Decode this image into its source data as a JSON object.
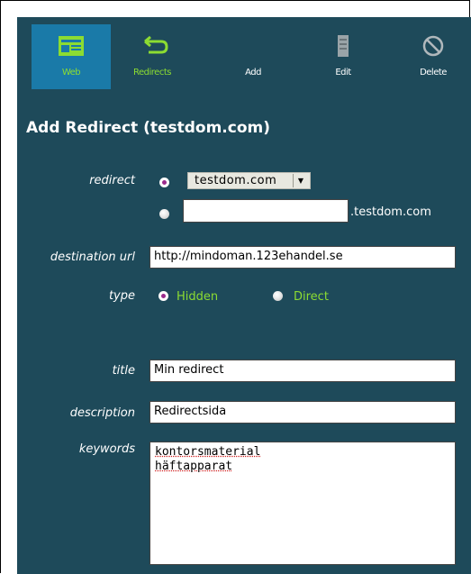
{
  "toolbar": {
    "items": [
      {
        "label": "Web",
        "icon": "web-icon",
        "active": true
      },
      {
        "label": "Redirects",
        "icon": "redirect-arrow-icon"
      },
      {
        "label": "Add",
        "icon": "add-icon"
      },
      {
        "label": "Edit",
        "icon": "edit-icon"
      },
      {
        "label": "Delete",
        "icon": "delete-icon"
      }
    ]
  },
  "heading": "Add Redirect (testdom.com)",
  "form": {
    "redirect_label": "redirect",
    "redirect_domain_selected": "testdom.com",
    "redirect_subdomain_value": "",
    "redirect_subdomain_suffix": ".testdom.com",
    "destination_label": "destination url",
    "destination_value": "http://mindoman.123ehandel.se",
    "type_label": "type",
    "type_options": [
      "Hidden",
      "Direct"
    ],
    "type_selected": "Hidden",
    "title_label": "title",
    "title_value": "Min redirect",
    "description_label": "description",
    "description_value": "Redirectsida",
    "keywords_label": "keywords",
    "keywords_lines": [
      "kontorsmaterial",
      "häftapparat"
    ]
  },
  "colors": {
    "panel_bg": "#1e4a5a",
    "active_tab_bg": "#1a7aa8",
    "accent_green": "#8cdc32",
    "radio_checked": "#9a2a8c"
  }
}
